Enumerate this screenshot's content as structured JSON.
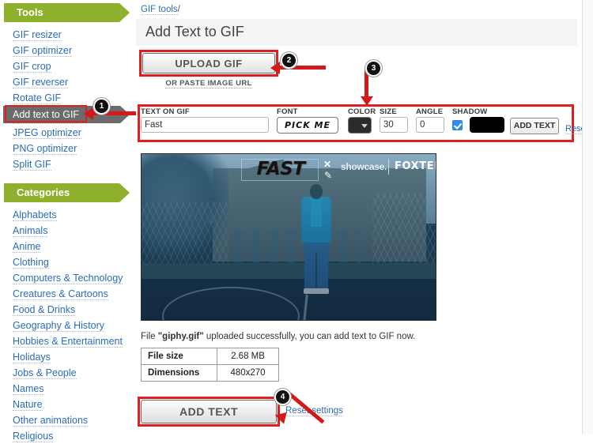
{
  "sidebar": {
    "tools_header": "Tools",
    "tools": [
      {
        "label": "GIF resizer"
      },
      {
        "label": "GIF optimizer"
      },
      {
        "label": "GIF crop"
      },
      {
        "label": "GIF reverser"
      },
      {
        "label": "Rotate GIF"
      },
      {
        "label": "Add text to GIF",
        "active": true
      },
      {
        "label": "JPEG optimizer"
      },
      {
        "label": "PNG optimizer"
      },
      {
        "label": "Split GIF"
      }
    ],
    "categories_header": "Categories",
    "categories": [
      {
        "label": "Alphabets"
      },
      {
        "label": "Animals"
      },
      {
        "label": "Anime"
      },
      {
        "label": "Clothing"
      },
      {
        "label": "Computers & Technology"
      },
      {
        "label": "Creatures & Cartoons"
      },
      {
        "label": "Food & Drinks"
      },
      {
        "label": "Geography & History"
      },
      {
        "label": "Hobbies & Entertainment"
      },
      {
        "label": "Holidays"
      },
      {
        "label": "Jobs & People"
      },
      {
        "label": "Names"
      },
      {
        "label": "Nature"
      },
      {
        "label": "Other animations"
      },
      {
        "label": "Religious"
      }
    ]
  },
  "main": {
    "breadcrumb_link": "GIF tools",
    "breadcrumb_sep": "/",
    "page_title": "Add Text to GIF",
    "upload_button": "UPLOAD GIF",
    "paste_url_label": "OR PASTE IMAGE URL"
  },
  "toolbar": {
    "text_label": "TEXT ON GIF",
    "text_value": "Fast",
    "font_label": "FONT",
    "font_value": "PICK ME",
    "color_label": "COLOR",
    "color_value": "#2b2b2b",
    "size_label": "SIZE",
    "size_value": "30",
    "angle_label": "ANGLE",
    "angle_value": "0",
    "shadow_label": "SHADOW",
    "shadow_checked": true,
    "shadow_color": "#000000",
    "add_text_button": "ADD TEXT",
    "reset_link": "Reset"
  },
  "gif_preview": {
    "overlay_text": "FAST",
    "delete_icon": "✕",
    "edit_icon": "✎",
    "watermark_showcase": "showcase.",
    "watermark_channel": "FOXTEL"
  },
  "file_info": {
    "message_prefix": "File ",
    "filename": "\"giphy.gif\"",
    "message_suffix": " uploaded successfully, you can add text to GIF now.",
    "rows": [
      {
        "key": "File size",
        "value": "2.68 MB"
      },
      {
        "key": "Dimensions",
        "value": "480x270"
      }
    ]
  },
  "bottom": {
    "add_text_button": "ADD TEXT",
    "reset_settings_link": "Reset settings"
  },
  "annotations": {
    "badge_1": "1",
    "badge_2": "2",
    "badge_3": "3",
    "badge_4": "4",
    "highlight_color": "#e02020",
    "arrow_color": "#d31a1a"
  }
}
